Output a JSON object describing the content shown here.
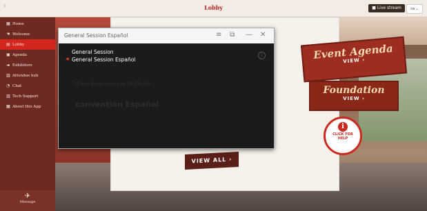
{
  "header": {
    "title": "Lobby",
    "live_stream": "Live stream",
    "language": "ca"
  },
  "sidebar": {
    "items": [
      {
        "label": "Home",
        "icon": "grid-icon",
        "glyph": "▦"
      },
      {
        "label": "Welcome",
        "icon": "hand-icon",
        "glyph": "☚"
      },
      {
        "label": "Lobby",
        "icon": "building-icon",
        "glyph": "▤"
      },
      {
        "label": "Agenda",
        "icon": "calendar-icon",
        "glyph": "▣"
      },
      {
        "label": "Exhibitors",
        "icon": "megaphone-icon",
        "glyph": "◄"
      },
      {
        "label": "Attendee hub",
        "icon": "people-icon",
        "glyph": "▥"
      },
      {
        "label": "Chat",
        "icon": "chat-icon",
        "glyph": "◔"
      },
      {
        "label": "Tech Support",
        "icon": "tool-icon",
        "glyph": "▥"
      },
      {
        "label": "About this App",
        "icon": "info-icon",
        "glyph": "▦"
      }
    ],
    "active_index": 2,
    "message": {
      "label": "Message",
      "icon": "paper-plane-icon",
      "glyph": "✈"
    }
  },
  "player": {
    "title": "General Session Español",
    "tracks": [
      {
        "label": "General Session",
        "selected": false
      },
      {
        "label": "General Session Español",
        "selected": true
      }
    ],
    "background_text": {
      "line1": "Starts Wednesday at 10:00 AM",
      "line2": "convention Español"
    }
  },
  "signs": {
    "event_agenda": {
      "title": "Event Agenda",
      "view": "VIEW ›"
    },
    "foundation": {
      "title": "Foundation",
      "view": "VIEW ›"
    },
    "help": {
      "line1": "CLICK FOR",
      "line2": "HELP"
    },
    "view_all": "VIEW ALL ›"
  },
  "colors": {
    "accent": "#d4261f",
    "sidebar": "#6e2a22",
    "sign": "#9c2d1f"
  }
}
